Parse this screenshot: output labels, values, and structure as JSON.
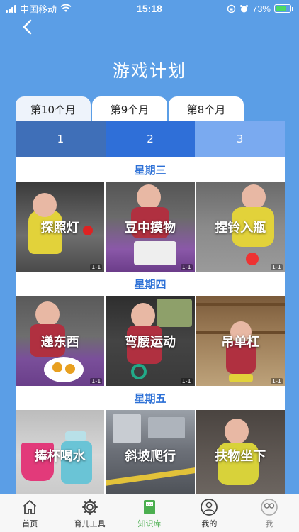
{
  "status_bar": {
    "carrier": "中国移动",
    "time": "15:18",
    "battery": "73%",
    "battery_level": 0.73
  },
  "page": {
    "title": "游戏计划"
  },
  "month_tabs": [
    {
      "label": "第10个月",
      "active": true
    },
    {
      "label": "第9个月",
      "active": false
    },
    {
      "label": "第8个月",
      "active": false
    }
  ],
  "week_tabs": [
    {
      "label": "1",
      "color": "#3f6fb8"
    },
    {
      "label": "2",
      "color": "#2f6fd8"
    },
    {
      "label": "3",
      "color": "#7aaaf0"
    }
  ],
  "days": [
    {
      "title": "星期三",
      "activities": [
        {
          "label": "探照灯",
          "badge": "1-1"
        },
        {
          "label": "豆中摸物",
          "badge": "1-1"
        },
        {
          "label": "捏铃入瓶",
          "badge": "1-1"
        }
      ]
    },
    {
      "title": "星期四",
      "activities": [
        {
          "label": "递东西",
          "badge": "1-1"
        },
        {
          "label": "弯腰运动",
          "badge": "1-1"
        },
        {
          "label": "吊单杠",
          "badge": "1-1"
        }
      ]
    },
    {
      "title": "星期五",
      "activities": [
        {
          "label": "捧杯喝水",
          "badge": ""
        },
        {
          "label": "斜坡爬行",
          "badge": ""
        },
        {
          "label": "扶物坐下",
          "badge": ""
        }
      ]
    }
  ],
  "tab_bar": [
    {
      "label": "首页",
      "icon": "home-icon",
      "active": false
    },
    {
      "label": "育儿工具",
      "icon": "gear-icon",
      "active": false
    },
    {
      "label": "知识库",
      "icon": "book-icon",
      "active": true
    },
    {
      "label": "我的",
      "icon": "user-icon",
      "active": false
    },
    {
      "label": "我",
      "icon": "face-icon",
      "active": false
    }
  ],
  "colors": {
    "background": "#5b9ee6",
    "accent_text": "#2b6fd6",
    "active_tab": "#4caf50"
  }
}
